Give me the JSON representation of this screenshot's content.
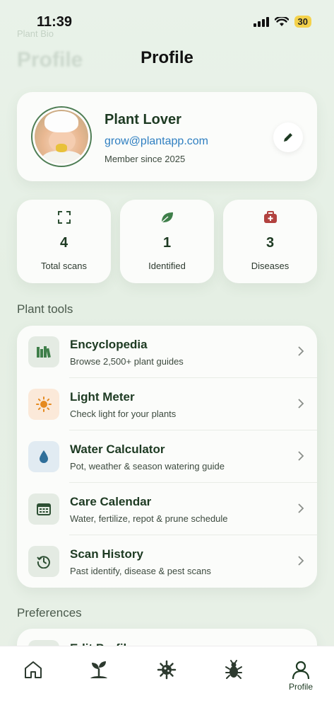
{
  "status_bar": {
    "time": "11:39",
    "battery": "30"
  },
  "header": {
    "ghost_small": "Plant Bio",
    "ghost_title": "Profile",
    "title": "Profile"
  },
  "profile": {
    "name": "Plant Lover",
    "email": "grow@plantapp.com",
    "member_since": "Member since 2025"
  },
  "stats": [
    {
      "icon": "scan-icon",
      "value": "4",
      "label": "Total scans",
      "color": "#2d4f33"
    },
    {
      "icon": "leaf-icon",
      "value": "1",
      "label": "Identified",
      "color": "#3f7f4a"
    },
    {
      "icon": "first-aid-icon",
      "value": "3",
      "label": "Diseases",
      "color": "#b2423f"
    }
  ],
  "plant_tools": {
    "title": "Plant tools",
    "items": [
      {
        "icon": "books-icon",
        "title": "Encyclopedia",
        "subtitle": "Browse 2,500+ plant guides",
        "bg": "#e4ebe3"
      },
      {
        "icon": "sun-icon",
        "title": "Light Meter",
        "subtitle": "Check light for your plants",
        "bg": "#fbe9d9"
      },
      {
        "icon": "water-drop-icon",
        "title": "Water Calculator",
        "subtitle": "Pot, weather & season watering guide",
        "bg": "#e1ebf2"
      },
      {
        "icon": "calendar-icon",
        "title": "Care Calendar",
        "subtitle": "Water, fertilize, repot & prune schedule",
        "bg": "#e4ebe3"
      },
      {
        "icon": "history-icon",
        "title": "Scan History",
        "subtitle": "Past identify, disease & pest scans",
        "bg": "#e4ebe3"
      }
    ]
  },
  "preferences": {
    "title": "Preferences",
    "first_item": "Edit Profile"
  },
  "tabbar": {
    "items": [
      {
        "icon": "home-icon",
        "label": ""
      },
      {
        "icon": "plant-icon",
        "label": ""
      },
      {
        "icon": "virus-icon",
        "label": ""
      },
      {
        "icon": "bug-icon",
        "label": ""
      },
      {
        "icon": "profile-icon",
        "label": "Profile"
      }
    ],
    "active": "Profile"
  },
  "colors": {
    "accent": "#3f7f4a",
    "link": "#2f7fc1",
    "danger": "#b2423f"
  }
}
